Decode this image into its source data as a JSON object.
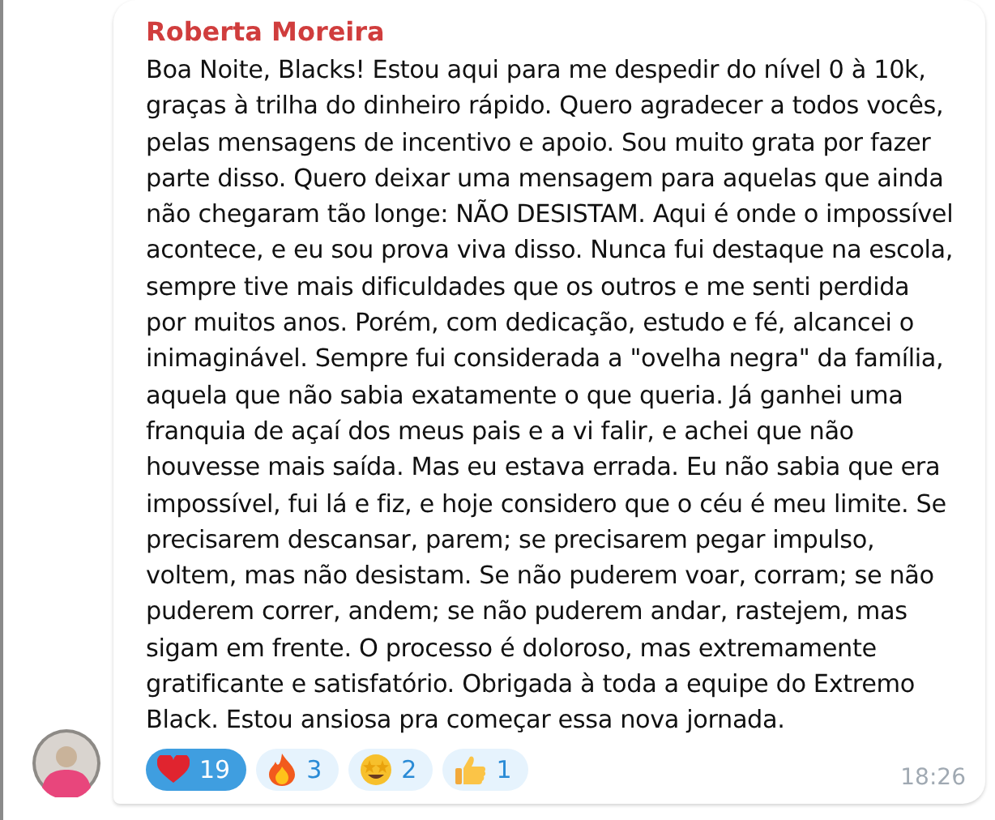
{
  "message": {
    "author": "Roberta Moreira",
    "text": "Boa Noite, Blacks! Estou aqui para me despedir do nível 0 à 10k,\ngraças à trilha do dinheiro rápido. Quero agradecer a todos vocês,\npelas mensagens de incentivo e apoio. Sou muito grata por fazer\nparte disso. Quero deixar uma mensagem para aquelas que ainda\nnão chegaram tão longe: NÃO DESISTAM. Aqui é onde o impossível\nacontece, e eu sou prova viva disso. Nunca fui destaque na escola,\nsempre tive mais dificuldades que os outros e me senti perdida\npor muitos anos. Porém, com dedicação, estudo e fé, alcancei o\ninimaginável. Sempre fui considerada a \"ovelha negra\" da família,\naquela que não sabia exatamente o que queria. Já ganhei uma\nfranquia de açaí dos meus pais e a vi falir, e achei que não\nhouvesse mais saída. Mas eu estava errada. Eu não sabia que era\nimpossível, fui lá e fiz, e hoje considero que o céu é meu limite.  Se\nprecisarem descansar, parem; se precisarem pegar impulso,\nvoltem, mas não desistam. Se não puderem voar, corram; se não\npuderem correr, andem; se não puderem andar, rastejem, mas\nsigam em frente. O processo é doloroso, mas extremamente\ngratificante e satisfatório. Obrigada à toda a equipe do Extremo\nBlack. Estou ansiosa pra começar essa nova jornada.",
    "time": "18:26",
    "reactions": [
      {
        "kind": "heart",
        "count": "19",
        "selected": true
      },
      {
        "kind": "fire",
        "count": "3",
        "selected": false
      },
      {
        "kind": "star-eyes",
        "count": "2",
        "selected": false
      },
      {
        "kind": "thumbs-up",
        "count": "1",
        "selected": false
      }
    ]
  }
}
